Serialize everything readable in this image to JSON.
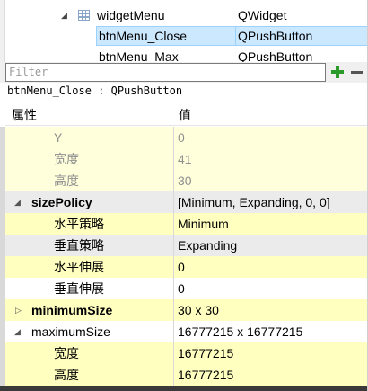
{
  "tree": {
    "parent_name": "widgetMenu",
    "parent_class": "QWidget",
    "selected_name": "btnMenu_Close",
    "selected_class": "QPushButton",
    "next_name": "btnMenu_Max",
    "next_class": "QPushButton"
  },
  "filter": {
    "placeholder": "Filter",
    "value": ""
  },
  "object_label": "btnMenu_Close : QPushButton",
  "header": {
    "property": "属性",
    "value": "值"
  },
  "properties": [
    {
      "name": "Y",
      "value": "0",
      "indent": 2,
      "disabled": true
    },
    {
      "name": "宽度",
      "value": "41",
      "indent": 2,
      "disabled": true
    },
    {
      "name": "高度",
      "value": "30",
      "indent": 2,
      "disabled": true
    },
    {
      "name": "sizePolicy",
      "value": "[Minimum, Expanding, 0, 0]",
      "bold": true,
      "expanded": true
    },
    {
      "name": "水平策略",
      "value": "Minimum",
      "indent": 2
    },
    {
      "name": "垂直策略",
      "value": "Expanding",
      "indent": 2
    },
    {
      "name": "水平伸展",
      "value": "0",
      "indent": 2
    },
    {
      "name": "垂直伸展",
      "value": "0",
      "indent": 2
    },
    {
      "name": "minimumSize",
      "value": "30 x 30",
      "bold": true,
      "expanded": false
    },
    {
      "name": "maximumSize",
      "value": "16777215 x 16777215",
      "expanded": true
    },
    {
      "name": "宽度",
      "value": "16777215",
      "indent": 2
    },
    {
      "name": "高度",
      "value": "16777215",
      "indent": 2
    }
  ]
}
